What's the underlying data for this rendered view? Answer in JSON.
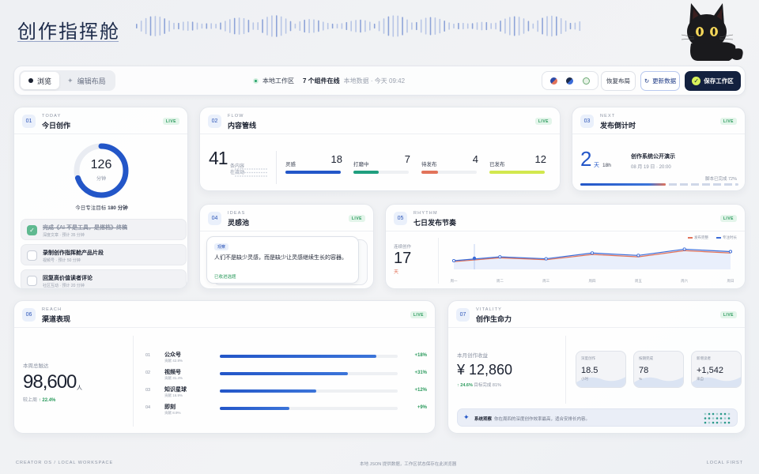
{
  "header": {
    "title": "创作指挥舱"
  },
  "toolbar": {
    "tab_browse": "浏览",
    "tab_edit": "编辑布局",
    "local_workspace": "本地工作区",
    "online": "7 个组件在线",
    "local_data": "本地数据 · 今天 09:42",
    "restore": "恢复布局",
    "refresh": "更新数据",
    "save": "保存工作区"
  },
  "today": {
    "num": "01",
    "eng": "TODAY",
    "title": "今日创作",
    "badge": "LIVE",
    "minutes": "126",
    "unit": "分钟",
    "progress": 0.7,
    "goal_prefix": "今日专注目标",
    "goal_value": "180 分钟",
    "tasks": [
      {
        "title": "完成《AI 不是工具，是搭档》终稿",
        "sub": "深度文章 · 预计 35 分钟",
        "done": true
      },
      {
        "title": "录制创作指挥舱产品片段",
        "sub": "视频号 · 预计 50 分钟",
        "done": false
      },
      {
        "title": "回复高价值读者评论",
        "sub": "社区互动 · 预计 20 分钟",
        "done": false
      }
    ]
  },
  "flow": {
    "num": "02",
    "eng": "FLOW",
    "title": "内容管线",
    "badge": "LIVE",
    "total": "41",
    "total_label": "条内容在流动",
    "stages": [
      {
        "label": "灵感",
        "value": "18",
        "color": "#2356c8",
        "fill": 1.0
      },
      {
        "label": "打磨中",
        "value": "7",
        "color": "#1f9e7e",
        "fill": 0.45
      },
      {
        "label": "待发布",
        "value": "4",
        "color": "#e2735a",
        "fill": 0.3
      },
      {
        "label": "已发布",
        "value": "12",
        "color": "#d2e84e",
        "fill": 1.0
      }
    ]
  },
  "next": {
    "num": "03",
    "eng": "NEXT",
    "title": "发布倒计时",
    "badge": "LIVE",
    "days": "2",
    "days_unit": "天",
    "hours": "18h",
    "event": "创作系统公开演示",
    "date": "08 月 19 日 · 20:00",
    "ready": "脚本已完成 72%",
    "progress": 0.72
  },
  "ideas": {
    "num": "04",
    "eng": "IDEAS",
    "title": "灵感池",
    "badge": "LIVE",
    "tag": "观察",
    "quote": "人们不是缺少灵感，而是缺少让灵感继续生长的容器。",
    "action": "已收进选题"
  },
  "rhythm": {
    "num": "05",
    "eng": "RHYTHM",
    "title": "七日发布节奏",
    "badge": "LIVE",
    "streak_label": "连续创作",
    "streak": "17",
    "streak_unit": "天",
    "legend": [
      "发布完整",
      "专注时长"
    ]
  },
  "reach": {
    "num": "06",
    "eng": "REACH",
    "title": "渠道表现",
    "badge": "LIVE",
    "label": "本周总触达",
    "total": "98,600",
    "unit": "人",
    "change_prefix": "较上周",
    "change": "↑ 22.4%",
    "channels": [
      {
        "idx": "01",
        "name": "公众号",
        "share": "贡献 42.8%",
        "fill": 0.88,
        "delta": "+18%"
      },
      {
        "idx": "02",
        "name": "视频号",
        "share": "贡献 31.4%",
        "fill": 0.72,
        "delta": "+31%"
      },
      {
        "idx": "03",
        "name": "知识星球",
        "share": "贡献 16.9%",
        "fill": 0.54,
        "delta": "+12%"
      },
      {
        "idx": "04",
        "name": "即刻",
        "share": "贡献 8.9%",
        "fill": 0.39,
        "delta": "+9%"
      }
    ]
  },
  "vitality": {
    "num": "07",
    "eng": "VITALITY",
    "title": "创作生命力",
    "badge": "LIVE",
    "label": "本月创作收益",
    "amount": "¥ 12,860",
    "change": "↑ 24.6%",
    "target": "目标完成 81%",
    "metrics": [
      {
        "label": "深度创作",
        "value": "18.5",
        "unit": "小时"
      },
      {
        "label": "按期完成",
        "value": "78",
        "unit": "%"
      },
      {
        "label": "新增读者",
        "value": "+1,542",
        "unit": "来自"
      }
    ],
    "insight_title": "系统观察",
    "insight_text": "你在周四的深度创作效率最高，适合安排长内容。"
  },
  "chart_data": {
    "type": "line",
    "categories": [
      "周一",
      "周二",
      "周三",
      "周四",
      "周五",
      "周六",
      "周日"
    ],
    "series": [
      {
        "name": "发布完整",
        "color": "#e2735a",
        "values": [
          2.6,
          3.4,
          3.0,
          4.1,
          3.6,
          4.9,
          4.4
        ]
      },
      {
        "name": "专注时长",
        "color": "#3a6bd8",
        "values": [
          2.8,
          3.6,
          3.2,
          4.4,
          3.9,
          5.2,
          4.7
        ]
      }
    ],
    "ylim": [
      0,
      7
    ]
  },
  "footer": {
    "left": "CREATOR OS / LOCAL WORKSPACE",
    "center": "本地 JSON 提供数据，工作区状态保存在此浏览器",
    "right": "LOCAL FIRST"
  }
}
